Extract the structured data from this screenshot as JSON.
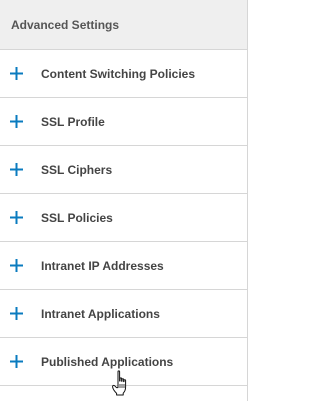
{
  "panel": {
    "title": "Advanced Settings",
    "items": [
      {
        "label": "Content Switching Policies",
        "icon": "plus-icon"
      },
      {
        "label": "SSL Profile",
        "icon": "plus-icon"
      },
      {
        "label": "SSL Ciphers",
        "icon": "plus-icon"
      },
      {
        "label": "SSL Policies",
        "icon": "plus-icon"
      },
      {
        "label": "Intranet IP Addresses",
        "icon": "plus-icon"
      },
      {
        "label": "Intranet Applications",
        "icon": "plus-icon"
      },
      {
        "label": "Published Applications",
        "icon": "plus-icon"
      }
    ]
  },
  "colors": {
    "accent": "#0a7bbf",
    "header_bg": "#efefef",
    "divider": "#d6d6d6",
    "text": "#444444"
  },
  "cursor": {
    "icon": "hand-pointer-icon"
  }
}
